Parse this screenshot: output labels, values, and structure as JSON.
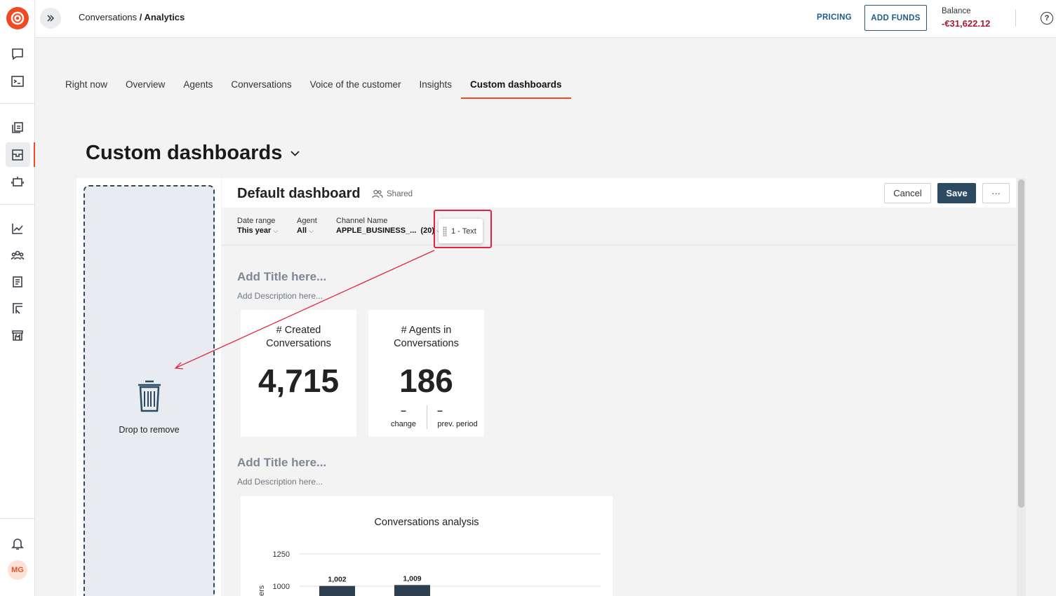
{
  "topbar": {
    "breadcrumb_parent": "Conversations",
    "breadcrumb_sep": " / ",
    "breadcrumb_current": "Analytics",
    "pricing": "PRICING",
    "add_funds": "ADD FUNDS",
    "balance_label": "Balance",
    "balance_value": "-€31,622.12",
    "help": "?"
  },
  "sidebar": {
    "avatar_initials": "MG",
    "items": [
      "chat-icon",
      "terminal-icon",
      "copy-icon",
      "inbox-icon",
      "bot-icon",
      "analytics-icon",
      "team-icon",
      "book-icon",
      "report-icon",
      "store-icon",
      "bell-icon"
    ],
    "accent": "#ef4a23"
  },
  "tabs": [
    {
      "label": "Right now"
    },
    {
      "label": "Overview"
    },
    {
      "label": "Agents"
    },
    {
      "label": "Conversations"
    },
    {
      "label": "Voice of the customer"
    },
    {
      "label": "Insights"
    },
    {
      "label": "Custom dashboards",
      "active": true
    }
  ],
  "page": {
    "title": "Custom dashboards"
  },
  "dropzone": {
    "label": "Drop to remove"
  },
  "dashboard": {
    "name": "Default dashboard",
    "shared": "Shared",
    "cancel": "Cancel",
    "save": "Save",
    "more": "···",
    "filters": [
      {
        "label": "Date range",
        "value": "This year"
      },
      {
        "label": "Agent",
        "value": "All"
      },
      {
        "label": "Channel Name",
        "value": "APPLE_BUSINESS_...  (20)"
      }
    ],
    "dragging_chip": "1 - Text",
    "sections": [
      {
        "title": "Add Title here...",
        "description": "Add Description here..."
      },
      {
        "title": "Add Title here...",
        "description": "Add Description here..."
      }
    ],
    "cards": [
      {
        "title_line1": "# Created",
        "title_line2": "Conversations",
        "value": "4,715"
      },
      {
        "title_line1": "# Agents in",
        "title_line2": "Conversations",
        "value": "186",
        "change": "–",
        "change_label": "change",
        "prev": "–",
        "prev_label": "prev. period"
      }
    ]
  },
  "chart_data": {
    "type": "bar",
    "title": "Conversations analysis",
    "ylabel": "ers",
    "yticks": [
      1000,
      1250
    ],
    "ylim": [
      1000,
      1250
    ],
    "categories": [
      "",
      ""
    ],
    "values": [
      1002,
      1009
    ],
    "data_labels": [
      "1,002",
      "1,009"
    ],
    "bar_color": "#2c3e50"
  }
}
